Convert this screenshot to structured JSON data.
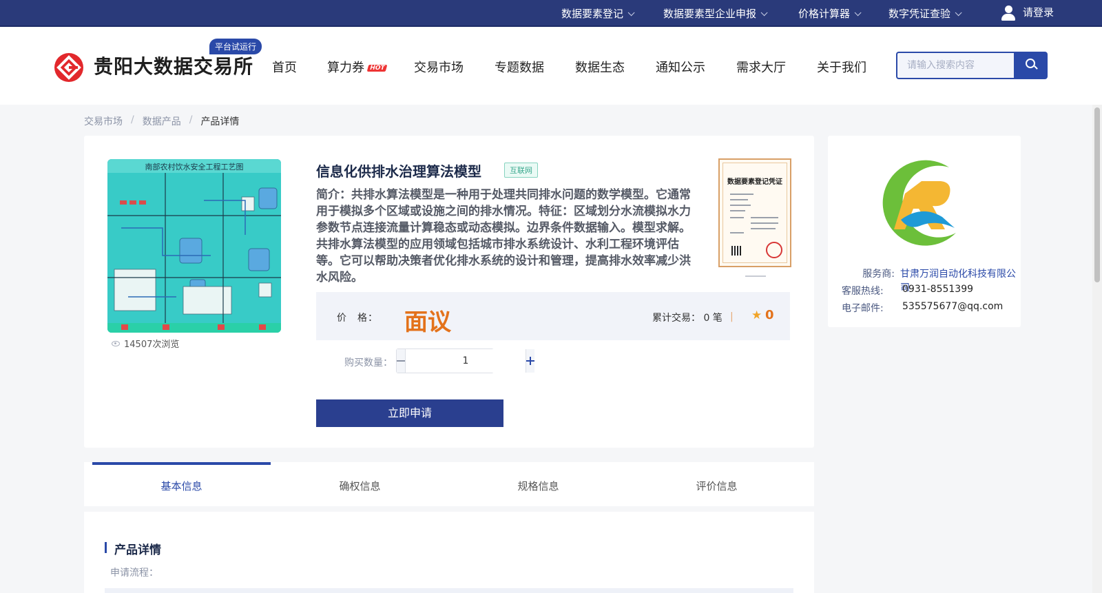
{
  "topbar": {
    "items": [
      "数据要素登记",
      "数据要素型企业申报",
      "价格计算器",
      "数字凭证查验"
    ],
    "login_label": "请登录"
  },
  "header": {
    "logo_text": "贵阳大数据交易所",
    "beta_badge": "平台试运行",
    "nav": [
      "首页",
      "算力券",
      "交易市场",
      "专题数据",
      "数据生态",
      "通知公示",
      "需求大厅",
      "关于我们"
    ],
    "hot_tag": "HOT",
    "search_placeholder": "请输入搜索内容"
  },
  "breadcrumb": {
    "items": [
      "交易市场",
      "数据产品",
      "产品详情"
    ],
    "separator": "/"
  },
  "product": {
    "title": "信息化供排水治理算法模型",
    "source_tag": "互联网",
    "description": "简介：共排水算法模型是一种用于处理共同排水问题的数学模型。它通常用于模拟多个区域或设施之间的排水情况。特征：区域划分水流模拟水力参数节点连接流量计算稳态或动态模拟。边界条件数据输入。模型求解。共排水算法模型的应用领域包括城市排水系统设计、水利工程环境评估等。它可以帮助决策者优化排水系统的设计和管理，提高排水效率减少洪水风险。",
    "image_caption": "南部农村饮水安全工程工艺图",
    "view_count": "14507次浏览",
    "cert_title": "数据要素登记凭证",
    "price_label": "价　格：",
    "price_value": "面议",
    "trade_count": "累计交易： 0 笔",
    "trade_separator": "|",
    "rating": "0",
    "qty_label": "购买数量：",
    "qty_value": "1",
    "apply_label": "立即申请"
  },
  "provider": {
    "provider_label": "服务商:",
    "provider_name": "甘肃万润自动化科技有限公司",
    "hotline_label": "客服热线:",
    "hotline": "0931-8551399",
    "email_label": "电子邮件:",
    "email": "535575677@qq.com"
  },
  "tabs": [
    "基本信息",
    "确权信息",
    "规格信息",
    "评价信息"
  ],
  "detail": {
    "title": "产品详情",
    "subtitle": "申请流程："
  },
  "colors": {
    "brand_blue": "#2a49a8",
    "topbar": "#2a3a7a",
    "price_orange": "#e3721b",
    "logo_red": "#e2282c"
  }
}
